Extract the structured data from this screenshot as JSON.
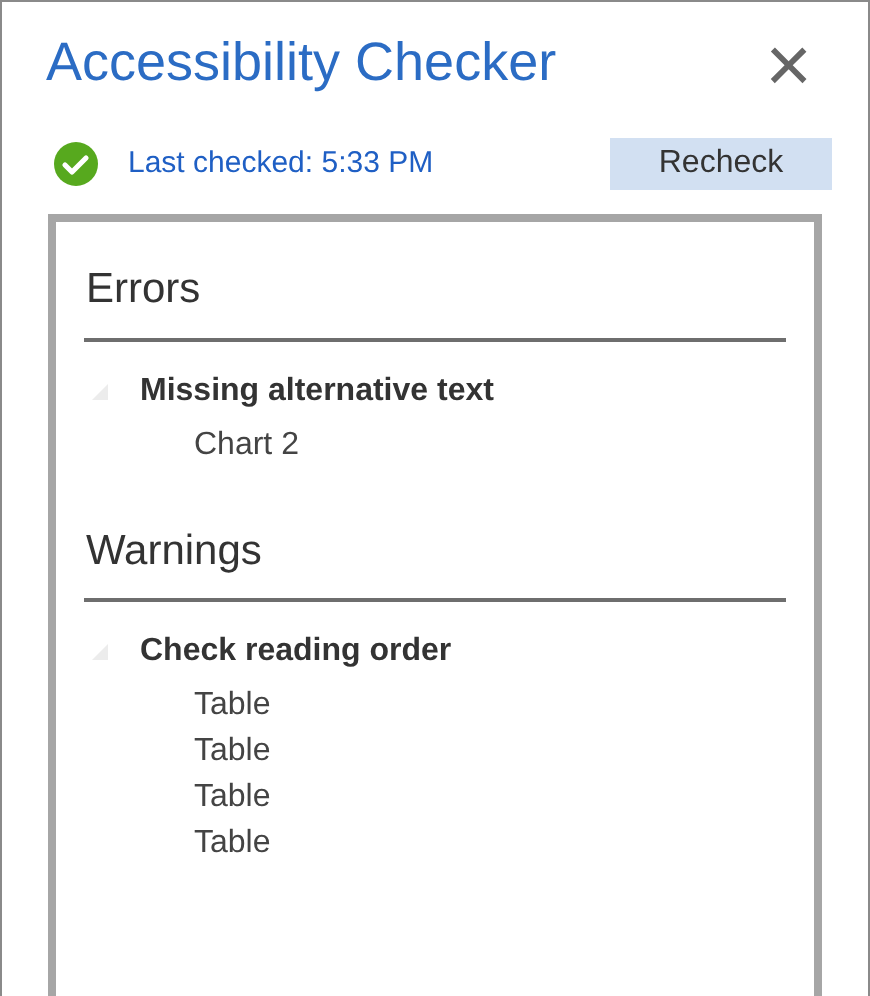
{
  "window": {
    "title": "Accessibility Checker",
    "close": "×"
  },
  "status": {
    "text": "Last checked: 5:33 PM",
    "ok": true
  },
  "recheck_button": "Recheck",
  "sections": [
    {
      "heading": "Errors",
      "issues": [
        {
          "title": "Missing alternative text",
          "expanded": true,
          "items": [
            "Chart 2"
          ]
        }
      ]
    },
    {
      "heading": "Warnings",
      "issues": [
        {
          "title": "Check reading order",
          "expanded": true,
          "items": [
            "Table",
            "Table",
            "Table",
            "Table"
          ]
        }
      ]
    }
  ]
}
